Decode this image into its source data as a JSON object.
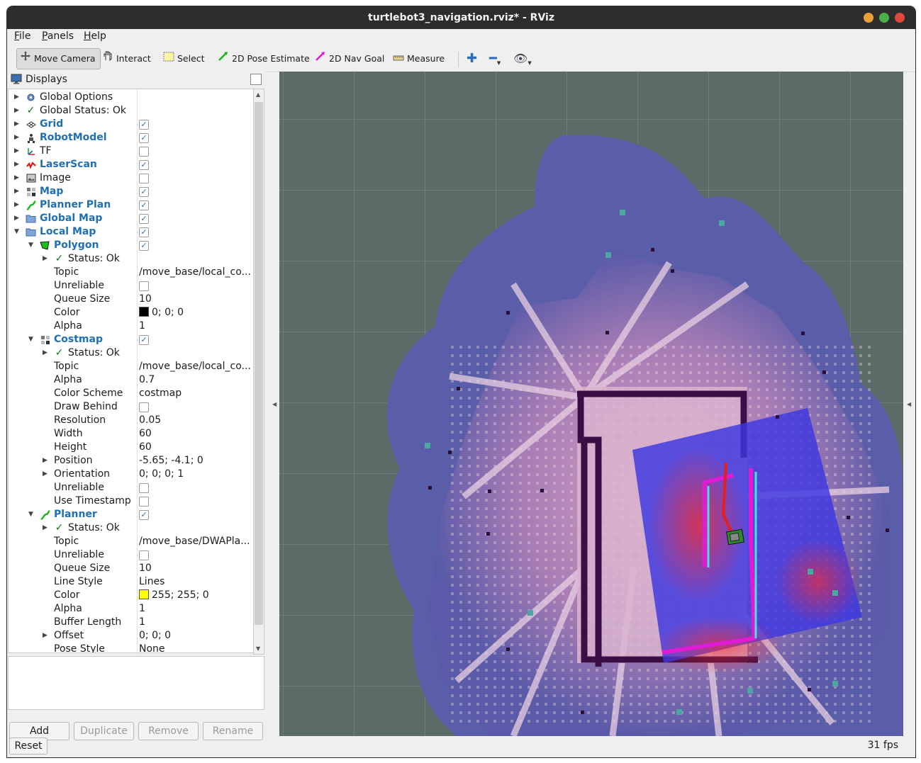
{
  "window": {
    "title": "turtlebot3_navigation.rviz* - RViz",
    "controls": [
      "minimize",
      "maximize",
      "close"
    ]
  },
  "menu": [
    {
      "label": "File",
      "mnemonic": "F",
      "rest": "ile"
    },
    {
      "label": "Panels",
      "mnemonic": "P",
      "rest": "anels"
    },
    {
      "label": "Help",
      "mnemonic": "H",
      "rest": "elp"
    }
  ],
  "toolbar": {
    "move_camera": "Move Camera",
    "interact": "Interact",
    "select": "Select",
    "pose_estimate": "2D Pose Estimate",
    "nav_goal": "2D Nav Goal",
    "measure": "Measure"
  },
  "displays": {
    "title": "Displays",
    "rows": [
      {
        "label": "Global Options",
        "icon": "gear-icon",
        "indent": 0,
        "expander": "closed",
        "bold": false
      },
      {
        "label": "Global Status: Ok",
        "icon": "check-icon",
        "indent": 0,
        "expander": "closed",
        "bold": false
      },
      {
        "label": "Grid",
        "icon": "grid-icon",
        "indent": 0,
        "expander": "closed",
        "bold": true,
        "checked": true
      },
      {
        "label": "RobotModel",
        "icon": "robot-icon",
        "indent": 0,
        "expander": "closed",
        "bold": true,
        "checked": true
      },
      {
        "label": "TF",
        "icon": "axes-icon",
        "indent": 0,
        "expander": "closed",
        "bold": false,
        "checked": false
      },
      {
        "label": "LaserScan",
        "icon": "laser-icon",
        "indent": 0,
        "expander": "closed",
        "bold": true,
        "checked": true
      },
      {
        "label": "Image",
        "icon": "image-icon",
        "indent": 0,
        "expander": "closed",
        "bold": false,
        "checked": false
      },
      {
        "label": "Map",
        "icon": "map-icon",
        "indent": 0,
        "expander": "closed",
        "bold": true,
        "checked": true
      },
      {
        "label": "Planner Plan",
        "icon": "path-icon",
        "indent": 0,
        "expander": "closed",
        "bold": true,
        "checked": true
      },
      {
        "label": "Global Map",
        "icon": "folder-icon",
        "indent": 0,
        "expander": "closed",
        "bold": true,
        "checked": true
      },
      {
        "label": "Local Map",
        "icon": "folder-icon",
        "indent": 0,
        "expander": "open",
        "bold": true,
        "checked": true
      },
      {
        "label": "Polygon",
        "icon": "polygon-icon",
        "indent": 1,
        "expander": "open",
        "bold": true,
        "checked": true
      },
      {
        "label": "Status: Ok",
        "icon": "check-icon",
        "indent": 2,
        "expander": "closed",
        "bold": false
      },
      {
        "label": "Topic",
        "indent": 2,
        "value": "/move_base/local_co..."
      },
      {
        "label": "Unreliable",
        "indent": 2,
        "checked": false
      },
      {
        "label": "Queue Size",
        "indent": 2,
        "value": "10"
      },
      {
        "label": "Color",
        "indent": 2,
        "value": "0; 0; 0",
        "swatch": "#000000"
      },
      {
        "label": "Alpha",
        "indent": 2,
        "value": "1"
      },
      {
        "label": "Costmap",
        "icon": "map-icon",
        "indent": 1,
        "expander": "open",
        "bold": true,
        "checked": true
      },
      {
        "label": "Status: Ok",
        "icon": "check-icon",
        "indent": 2,
        "expander": "closed",
        "bold": false
      },
      {
        "label": "Topic",
        "indent": 2,
        "value": "/move_base/local_co..."
      },
      {
        "label": "Alpha",
        "indent": 2,
        "value": "0.7"
      },
      {
        "label": "Color Scheme",
        "indent": 2,
        "value": "costmap"
      },
      {
        "label": "Draw Behind",
        "indent": 2,
        "checked": false
      },
      {
        "label": "Resolution",
        "indent": 2,
        "value": "0.05"
      },
      {
        "label": "Width",
        "indent": 2,
        "value": "60"
      },
      {
        "label": "Height",
        "indent": 2,
        "value": "60"
      },
      {
        "label": "Position",
        "indent": 2,
        "expander": "closed",
        "value": "-5.65; -4.1; 0"
      },
      {
        "label": "Orientation",
        "indent": 2,
        "expander": "closed",
        "value": "0; 0; 0; 1"
      },
      {
        "label": "Unreliable",
        "indent": 2,
        "checked": false
      },
      {
        "label": "Use Timestamp",
        "indent": 2,
        "checked": false
      },
      {
        "label": "Planner",
        "icon": "path-icon",
        "indent": 1,
        "expander": "open",
        "bold": true,
        "checked": true
      },
      {
        "label": "Status: Ok",
        "icon": "check-icon",
        "indent": 2,
        "expander": "closed",
        "bold": false
      },
      {
        "label": "Topic",
        "indent": 2,
        "value": "/move_base/DWAPla..."
      },
      {
        "label": "Unreliable",
        "indent": 2,
        "checked": false
      },
      {
        "label": "Queue Size",
        "indent": 2,
        "value": "10"
      },
      {
        "label": "Line Style",
        "indent": 2,
        "value": "Lines"
      },
      {
        "label": "Color",
        "indent": 2,
        "value": "255; 255; 0",
        "swatch": "#ffff00"
      },
      {
        "label": "Alpha",
        "indent": 2,
        "value": "1"
      },
      {
        "label": "Buffer Length",
        "indent": 2,
        "value": "1"
      },
      {
        "label": "Offset",
        "indent": 2,
        "expander": "closed",
        "value": "0; 0; 0"
      },
      {
        "label": "Pose Style",
        "indent": 2,
        "value": "None"
      }
    ]
  },
  "buttons": {
    "add": "Add",
    "duplicate": "Duplicate",
    "remove": "Remove",
    "rename": "Rename",
    "reset": "Reset"
  },
  "status": {
    "fps": "31 fps"
  }
}
